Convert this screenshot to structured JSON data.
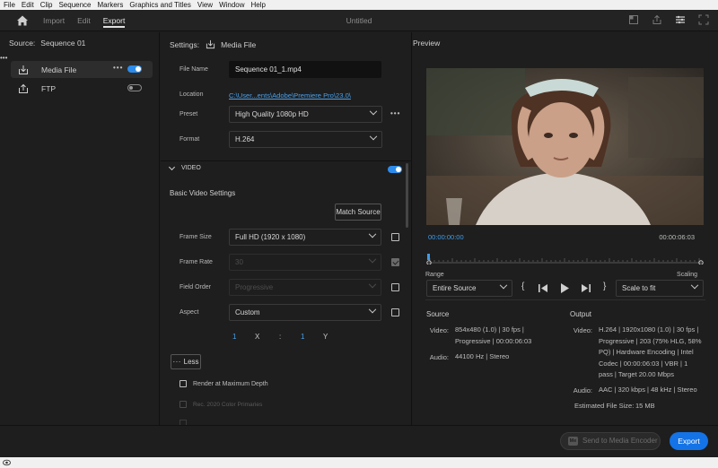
{
  "menu": [
    "File",
    "Edit",
    "Clip",
    "Sequence",
    "Markers",
    "Graphics and Titles",
    "View",
    "Window",
    "Help"
  ],
  "header": {
    "tabs": [
      {
        "label": "Import",
        "active": false
      },
      {
        "label": "Edit",
        "active": false
      },
      {
        "label": "Export",
        "active": true
      }
    ],
    "doc_title": "Untitled"
  },
  "source": {
    "label": "Source:",
    "sequence": "Sequence 01",
    "more": "•••",
    "destinations": [
      {
        "label": "Media File",
        "enabled": true,
        "icon": "download-icon"
      },
      {
        "label": "FTP",
        "enabled": false,
        "icon": "upload-icon"
      }
    ]
  },
  "settings": {
    "label": "Settings:",
    "target": "Media File",
    "file_name_label": "File Name",
    "file_name": "Sequence 01_1.mp4",
    "location_label": "Location",
    "location": "C:\\User...ents\\Adobe\\Premiere Pro\\23.0\\",
    "preset_label": "Preset",
    "preset": "High Quality 1080p HD",
    "format_label": "Format",
    "format": "H.264"
  },
  "video": {
    "section": "VIDEO",
    "enabled": true,
    "basic_title": "Basic Video Settings",
    "match_source": "Match Source",
    "frame_size_label": "Frame Size",
    "frame_size": "Full HD (1920 x 1080)",
    "frame_rate_label": "Frame Rate",
    "frame_rate": "30",
    "field_order_label": "Field Order",
    "field_order": "Progressive",
    "aspect_label": "Aspect",
    "aspect": "Custom",
    "aspect_x": "1",
    "aspect_x_label": "X",
    "aspect_colon": ":",
    "aspect_y": "1",
    "aspect_y_label": "Y",
    "less": "Less",
    "render_max_depth": "Render at Maximum Depth",
    "rec2020": "Rec. 2020 Color Primaries"
  },
  "preview": {
    "label": "Preview",
    "timecode_start": "00:00:00:00",
    "timecode_end": "00:00:06:03",
    "range_label": "Range",
    "range": "Entire Source",
    "scaling_label": "Scaling",
    "scaling": "Scale to fit"
  },
  "source_info": {
    "title": "Source",
    "video_label": "Video:",
    "video_lines": [
      "854x480 (1.0)  |  30 fps  |",
      "Progressive  |  00:00:06:03"
    ],
    "audio_label": "Audio:",
    "audio": "44100 Hz  |  Stereo"
  },
  "output_info": {
    "title": "Output",
    "video_label": "Video:",
    "video_lines": [
      "H.264  |  1920x1080 (1.0)  |  30 fps  |",
      "Progressive  |  203 (75% HLG, 58%",
      "PQ)  |  Hardware Encoding  |  Intel",
      "Codec  |  00:00:06:03  |  VBR  |  1",
      "pass  |  Target 20.00 Mbps"
    ],
    "audio_label": "Audio:",
    "audio": "AAC  |  320 kbps  |  48 kHz  |  Stereo",
    "size_label": "Estimated File Size:",
    "size": "15 MB"
  },
  "footer": {
    "ame_badge": "Me",
    "send_to_ame": "Send to Media Encoder",
    "export": "Export"
  },
  "colors": {
    "accent": "#1473e6",
    "toggle": "#2d8ceb",
    "link": "#4aa0ea",
    "timecode": "#3f9be8"
  }
}
